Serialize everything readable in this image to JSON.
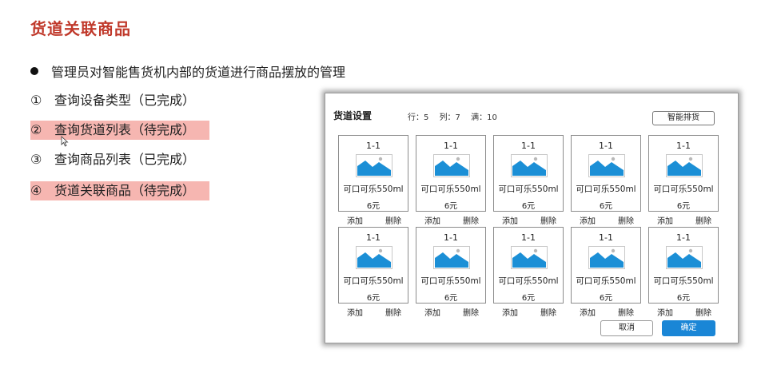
{
  "slide": {
    "title": "货道关联商品",
    "bullet": "管理员对智能售货机内部的货道进行商品摆放的管理",
    "steps": [
      {
        "num": "①",
        "text": "查询设备类型（已完成）",
        "highlight": false
      },
      {
        "num": "②",
        "text": "查询货道列表（待完成）",
        "highlight": true
      },
      {
        "num": "③",
        "text": "查询商品列表（已完成）",
        "highlight": false
      },
      {
        "num": "④",
        "text": "货道关联商品（待完成）",
        "highlight": true
      }
    ]
  },
  "panel": {
    "title": "货道设置",
    "stats": {
      "rows": "行：5",
      "cols": "列：7",
      "full": "满：10"
    },
    "smart_button": "智能排货",
    "cancel_button": "取消",
    "confirm_button": "确定",
    "cards": [
      {
        "slot": "1-1",
        "name": "可口可乐550ml",
        "price": "6元",
        "add": "添加",
        "delete": "删除"
      },
      {
        "slot": "1-1",
        "name": "可口可乐550ml",
        "price": "6元",
        "add": "添加",
        "delete": "删除"
      },
      {
        "slot": "1-1",
        "name": "可口可乐550ml",
        "price": "6元",
        "add": "添加",
        "delete": "删除"
      },
      {
        "slot": "1-1",
        "name": "可口可乐550ml",
        "price": "6元",
        "add": "添加",
        "delete": "删除"
      },
      {
        "slot": "1-1",
        "name": "可口可乐550ml",
        "price": "6元",
        "add": "添加",
        "delete": "删除"
      },
      {
        "slot": "1-1",
        "name": "可口可乐550ml",
        "price": "6元",
        "add": "添加",
        "delete": "删除"
      },
      {
        "slot": "1-1",
        "name": "可口可乐550ml",
        "price": "6元",
        "add": "添加",
        "delete": "删除"
      },
      {
        "slot": "1-1",
        "name": "可口可乐550ml",
        "price": "6元",
        "add": "添加",
        "delete": "删除"
      },
      {
        "slot": "1-1",
        "name": "可口可乐550ml",
        "price": "6元",
        "add": "添加",
        "delete": "删除"
      },
      {
        "slot": "1-1",
        "name": "可口可乐550ml",
        "price": "6元",
        "add": "添加",
        "delete": "删除"
      }
    ]
  },
  "colors": {
    "title_red": "#c0392b",
    "highlight": "#f6b6b1",
    "primary_blue": "#1a86d6",
    "image_blue": "#1b8fd6"
  }
}
